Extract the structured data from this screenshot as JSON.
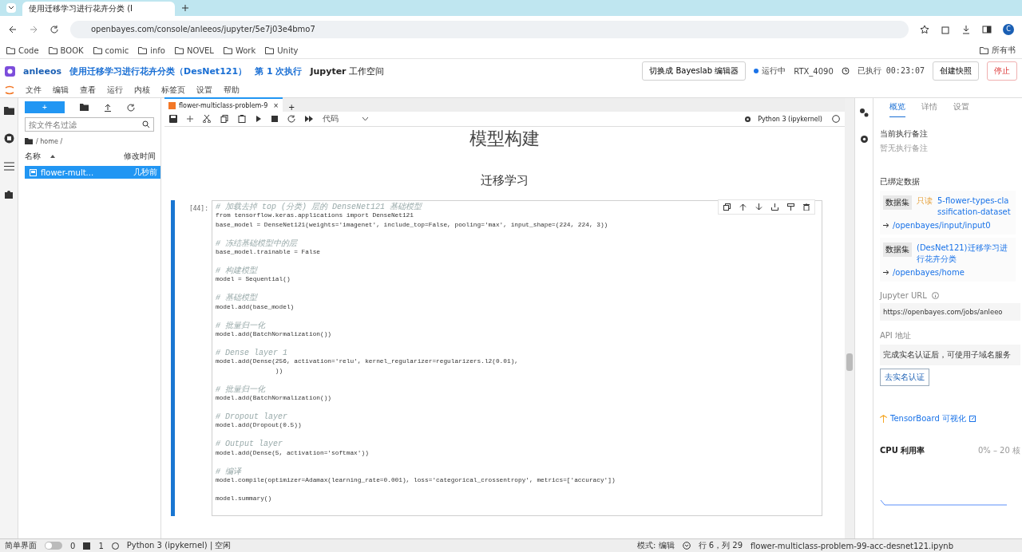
{
  "browser": {
    "tab_title": "使用迁移学习进行花卉分类 (I",
    "url": "openbayes.com/console/anleeos/jupyter/5e7j03e4bmo7",
    "avatar": "C",
    "bookmarks": [
      "Code",
      "BOOK",
      "comic",
      "info",
      "NOVEL",
      "Work",
      "Unity"
    ],
    "all_bookmarks": "所有书"
  },
  "header": {
    "user": "anleeos",
    "title": "使用迁移学习进行花卉分类（DesNet121）",
    "run": "第 1 次执行",
    "workspace_bold": "Jupyter",
    "workspace": "工作空间",
    "switch_button": "切换成 Bayeslab 编辑器",
    "status": "运行中",
    "gpu": "RTX_4090",
    "elapsed": "已执行 00:23:07",
    "snapshot_button": "创建快照",
    "stop_button": "停止"
  },
  "menu": [
    "文件",
    "编辑",
    "查看",
    "运行",
    "内核",
    "标签页",
    "设置",
    "帮助"
  ],
  "file_browser": {
    "new_button": "+",
    "filter_placeholder": "按文件名过滤",
    "path": "/ home /",
    "col_name": "名称",
    "col_modified": "修改时间",
    "files": [
      {
        "name": "flower-mult...",
        "modified": "几秒前",
        "selected": true
      }
    ]
  },
  "notebook": {
    "tab": "flower-multiclass-problem-9",
    "close": "×",
    "add": "+",
    "cell_type": "代码",
    "kernel": "Python 3 (ipykernel)",
    "heading": "模型构建",
    "subheading": "迁移学习",
    "prompt": "[44]:",
    "blocks": [
      [
        {
          "kind": "comment",
          "text": "# 加载去掉 top (分类) 层的 DenseNet121 基础模型"
        },
        {
          "kind": "code",
          "text": "from tensorflow.keras.applications import DenseNet121"
        },
        {
          "kind": "code",
          "text": "base_model = DenseNet121(weights='imagenet', include_top=False, pooling='max', input_shape=(224, 224, 3))"
        }
      ],
      [
        {
          "kind": "comment",
          "text": "# 冻结基础模型中的层"
        },
        {
          "kind": "code",
          "text": "base_model.trainable = False"
        }
      ],
      [
        {
          "kind": "comment",
          "text": "# 构建模型"
        },
        {
          "kind": "code",
          "text": "model = Sequential()"
        }
      ],
      [
        {
          "kind": "comment",
          "text": "# 基础模型"
        },
        {
          "kind": "code",
          "text": "model.add(base_model)"
        }
      ],
      [
        {
          "kind": "comment",
          "text": "# 批量归一化"
        },
        {
          "kind": "code",
          "text": "model.add(BatchNormalization())"
        }
      ],
      [
        {
          "kind": "comment",
          "text": "# Dense layer 1"
        },
        {
          "kind": "code",
          "text": "model.add(Dense(256, activation='relu', kernel_regularizer=regularizers.l2(0.01),"
        },
        {
          "kind": "code",
          "text": "                ))"
        }
      ],
      [
        {
          "kind": "comment",
          "text": "# 批量归一化"
        },
        {
          "kind": "code",
          "text": "model.add(BatchNormalization())"
        }
      ],
      [
        {
          "kind": "comment",
          "text": "# Dropout layer"
        },
        {
          "kind": "code",
          "text": "model.add(Dropout(0.5))"
        }
      ],
      [
        {
          "kind": "comment",
          "text": "# Output layer"
        },
        {
          "kind": "code",
          "text": "model.add(Dense(5, activation='softmax'))"
        }
      ],
      [
        {
          "kind": "comment",
          "text": "# 编译"
        },
        {
          "kind": "code",
          "text": "model.compile(optimizer=Adamax(learning_rate=0.001), loss='categorical_crossentropy', metrics=['accuracy'])"
        }
      ],
      [
        {
          "kind": "code",
          "text": "model.summary()"
        }
      ]
    ]
  },
  "panel": {
    "tabs": [
      {
        "label": "概览",
        "selected": true
      },
      {
        "label": "详情",
        "selected": false
      },
      {
        "label": "设置",
        "selected": false
      }
    ],
    "note_title": "当前执行备注",
    "note_empty": "暂无执行备注",
    "data_title": "已绑定数据",
    "datasets": [
      {
        "badge": "数据集",
        "tag": "只读",
        "name": "5-flower-types-classification-dataset",
        "path": "/openbayes/input/input0"
      },
      {
        "badge": "数据集",
        "name": "(DesNet121)迁移学习进行花卉分类",
        "path": "/openbayes/home"
      }
    ],
    "jupyter_label": "Jupyter URL",
    "jupyter_url": "https://openbayes.com/jobs/anleeo",
    "api_label": "API 地址",
    "api_text": "完成实名认证后，可使用子域名服务",
    "verify_button": "去实名认证",
    "tensorboard": "TensorBoard 可视化",
    "cpu_label": "CPU 利用率",
    "cpu_range": "0% – 20 核"
  },
  "status_bar": {
    "simple_mode": "简单界面",
    "simple_on": false,
    "count_a": "0",
    "count_b": "1",
    "kernel": "Python 3 (ipykernel) | 空闲",
    "mode": "模式: 编辑",
    "position": "行 6，列 29",
    "file": "flower-multiclass-problem-99-acc-desnet121.ipynb"
  }
}
